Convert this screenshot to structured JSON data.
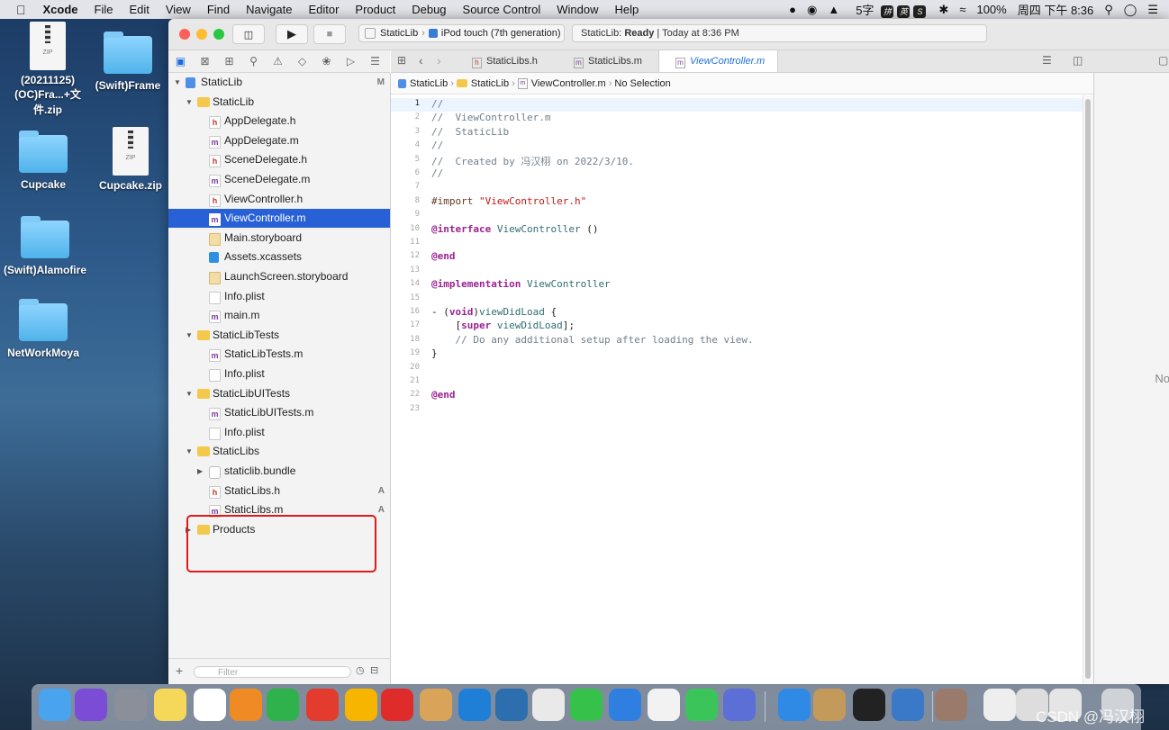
{
  "menubar": {
    "app": "Xcode",
    "items": [
      "File",
      "Edit",
      "View",
      "Find",
      "Navigate",
      "Editor",
      "Product",
      "Debug",
      "Source Control",
      "Window",
      "Help"
    ],
    "status": {
      "ime": "5字",
      "battery": "100%",
      "clock": "周四 下午 8:36"
    }
  },
  "desktop": [
    {
      "label": "(20211125)\n(OC)Fra...+文件.zip",
      "l1": "(20211125)",
      "l2": "(OC)Fra...+文件.zip",
      "kind": "zip"
    },
    {
      "label": "(Swift)Frame",
      "kind": "folder"
    },
    {
      "label": "Cupcake",
      "kind": "folder"
    },
    {
      "label": "Cupcake.zip",
      "kind": "zip"
    },
    {
      "label": "(Swift)Alamofire",
      "kind": "folder"
    },
    {
      "label": "NetWorkMoya",
      "kind": "folder"
    }
  ],
  "toolbar": {
    "scheme": "StaticLib",
    "device": "iPod touch (7th generation)",
    "status_project": "StaticLib:",
    "status_state": "Ready",
    "status_time": "| Today at 8:36 PM"
  },
  "tabs": [
    {
      "label": "StaticLibs.h",
      "kind": "h"
    },
    {
      "label": "StaticLibs.m",
      "kind": "m"
    },
    {
      "label": "ViewController.m",
      "kind": "m"
    }
  ],
  "jumpbar": {
    "p1": "StaticLib",
    "p2": "StaticLib",
    "p3": "ViewController.m",
    "p4": "No Selection"
  },
  "navigator": {
    "rows": [
      {
        "label": "StaticLib",
        "icon": "proj",
        "depth": 0,
        "tri": "▼",
        "badge": "M"
      },
      {
        "label": "StaticLib",
        "icon": "folder",
        "depth": 1,
        "tri": "▼"
      },
      {
        "label": "AppDelegate.h",
        "icon": "h",
        "depth": 2
      },
      {
        "label": "AppDelegate.m",
        "icon": "m",
        "depth": 2
      },
      {
        "label": "SceneDelegate.h",
        "icon": "h",
        "depth": 2
      },
      {
        "label": "SceneDelegate.m",
        "icon": "m",
        "depth": 2
      },
      {
        "label": "ViewController.h",
        "icon": "h",
        "depth": 2
      },
      {
        "label": "ViewController.m",
        "icon": "m",
        "depth": 2,
        "selected": true
      },
      {
        "label": "Main.storyboard",
        "icon": "story",
        "depth": 2
      },
      {
        "label": "Assets.xcassets",
        "icon": "assets",
        "depth": 2
      },
      {
        "label": "LaunchScreen.storyboard",
        "icon": "story",
        "depth": 2
      },
      {
        "label": "Info.plist",
        "icon": "plist",
        "depth": 2
      },
      {
        "label": "main.m",
        "icon": "m",
        "depth": 2
      },
      {
        "label": "StaticLibTests",
        "icon": "folder",
        "depth": 1,
        "tri": "▼"
      },
      {
        "label": "StaticLibTests.m",
        "icon": "m",
        "depth": 2
      },
      {
        "label": "Info.plist",
        "icon": "plist",
        "depth": 2
      },
      {
        "label": "StaticLibUITests",
        "icon": "folder",
        "depth": 1,
        "tri": "▼"
      },
      {
        "label": "StaticLibUITests.m",
        "icon": "m",
        "depth": 2
      },
      {
        "label": "Info.plist",
        "icon": "plist",
        "depth": 2
      },
      {
        "label": "StaticLibs",
        "icon": "folder",
        "depth": 1,
        "tri": "▼"
      },
      {
        "label": "staticlib.bundle",
        "icon": "bundle",
        "depth": 2,
        "tri": "▶"
      },
      {
        "label": "StaticLibs.h",
        "icon": "h",
        "depth": 2,
        "badge": "A"
      },
      {
        "label": "StaticLibs.m",
        "icon": "m",
        "depth": 2,
        "badge": "A"
      },
      {
        "label": "Products",
        "icon": "folder",
        "depth": 1,
        "tri": "▶"
      }
    ],
    "filter_placeholder": "Filter"
  },
  "code": [
    "//",
    "//  ViewController.m",
    "//  StaticLib",
    "//",
    "//  Created by 冯汉栩 on 2022/3/10.",
    "//",
    "",
    "#import \"ViewController.h\"",
    "",
    "@interface ViewController ()",
    "",
    "@end",
    "",
    "@implementation ViewController",
    "",
    "- (void)viewDidLoad {",
    "    [super viewDidLoad];",
    "    // Do any additional setup after loading the view.",
    "}",
    "",
    "",
    "@end",
    ""
  ],
  "inspector": {
    "empty": "No"
  },
  "watermark": "CSDN @冯汉栩",
  "colors": {
    "selection": "#2861d6",
    "keyword": "#9b2393",
    "string": "#c41a16",
    "comment": "#707f8c",
    "highlight": "#e01a1a"
  }
}
